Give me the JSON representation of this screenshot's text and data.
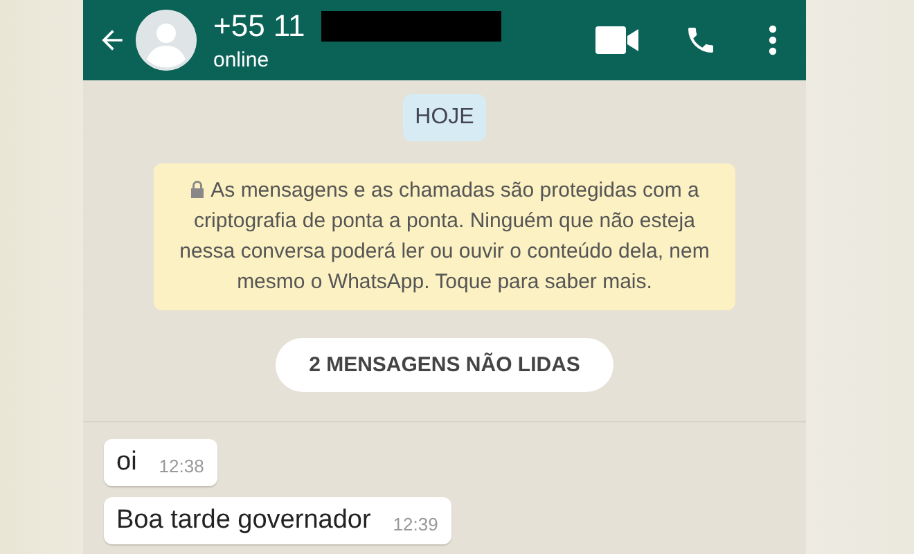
{
  "header": {
    "title": "+55 11",
    "status": "online",
    "redacted": true
  },
  "date_chip": "HOJE",
  "encryption_notice": "As mensagens e as chamadas são protegidas com a criptografia de ponta a ponta. Ninguém que não esteja nessa conversa poderá ler ou ouvir o conteúdo dela, nem mesmo o WhatsApp. Toque para saber mais.",
  "unread_chip": "2 MENSAGENS NÃO LIDAS",
  "messages": [
    {
      "text": "oi",
      "time": "12:38"
    },
    {
      "text": "Boa tarde governador",
      "time": "12:39"
    }
  ]
}
